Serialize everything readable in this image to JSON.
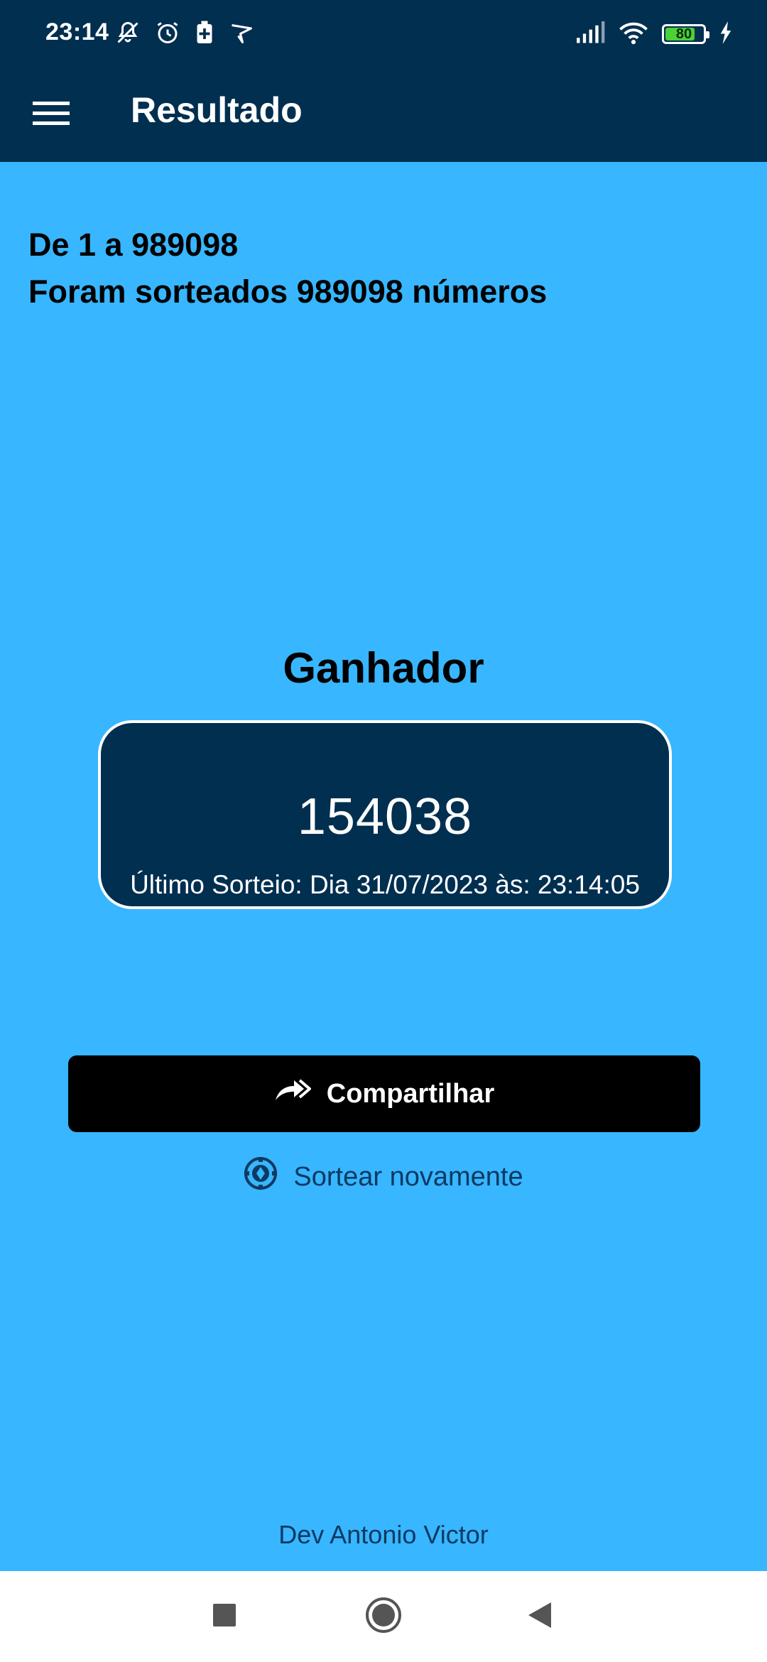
{
  "status_bar": {
    "time": "23:14",
    "battery_level": "80",
    "battery_fraction": 0.8,
    "icons": [
      "bell-off-icon",
      "alarm-icon",
      "battery-saver-icon",
      "notification-app-icon",
      "signal-icon",
      "wifi-icon",
      "battery-icon",
      "charging-icon"
    ]
  },
  "app_bar": {
    "title": "Resultado",
    "menu_icon": "menu-icon"
  },
  "summary": {
    "range": "De 1 a 989098",
    "drawn_count": "Foram sorteados 989098 números"
  },
  "winner": {
    "title": "Ganhador",
    "number": "154038",
    "last_draw": "Último Sorteio: Dia 31/07/2023 às: 23:14:05"
  },
  "actions": {
    "share_label": "Compartilhar",
    "share_icon": "share-arrow-icon",
    "redraw_label": "Sortear novamente",
    "redraw_icon": "draw-chip-icon"
  },
  "footer": {
    "credit": "Dev Antonio Victor"
  },
  "nav_bar": {
    "buttons": [
      "recents-icon",
      "home-icon",
      "back-icon"
    ]
  },
  "colors": {
    "background": "#38b6ff",
    "header": "#002f50",
    "card": "#002f50",
    "share_button": "#000000",
    "accent_text": "#0b3a62"
  }
}
